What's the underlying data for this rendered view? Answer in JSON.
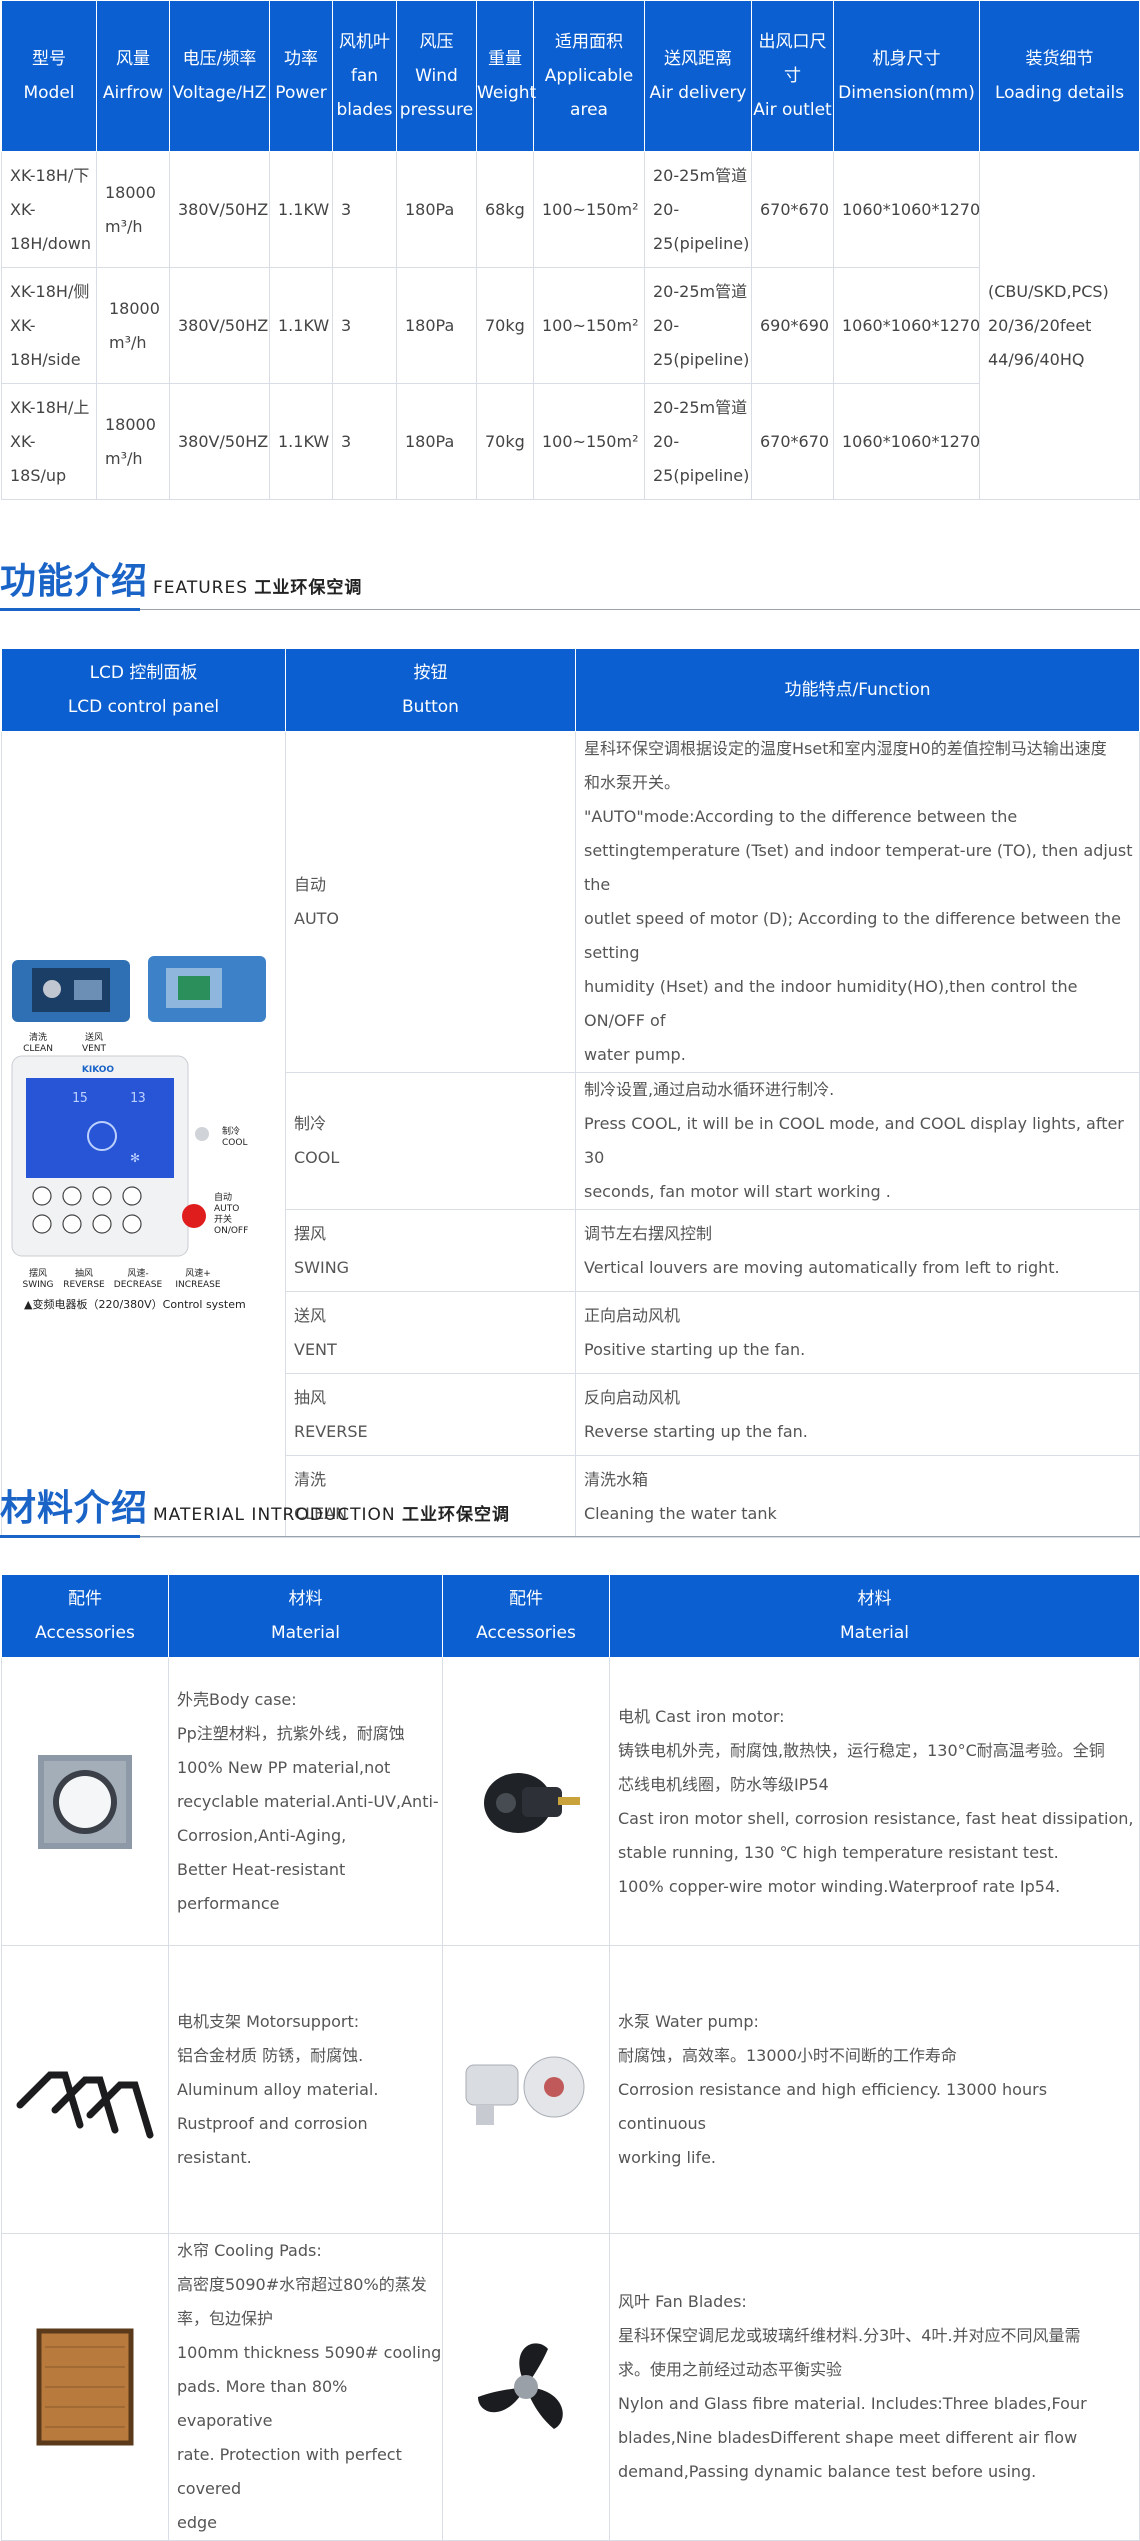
{
  "spec_table": {
    "headers": [
      {
        "zh": "型号",
        "en": "Model"
      },
      {
        "zh": "风量",
        "en": "Airfrow"
      },
      {
        "zh": "电压/频率",
        "en": "Voltage/HZ"
      },
      {
        "zh": "功率",
        "en": "Power"
      },
      {
        "zh": "风机叶",
        "en": "fan blades"
      },
      {
        "zh": "风压",
        "en": "Wind pressure"
      },
      {
        "zh": "重量",
        "en": "Weight"
      },
      {
        "zh": "适用面积",
        "en": "Applicable area"
      },
      {
        "zh": "送风距离",
        "en": "Air delivery"
      },
      {
        "zh": "出风口尺寸",
        "en": "Air outlet"
      },
      {
        "zh": "机身尺寸",
        "en": "Dimension(mm)"
      },
      {
        "zh": "装货细节",
        "en": "Loading details"
      }
    ],
    "rows": [
      {
        "model_a": "XK-18H/下",
        "model_b": "XK-",
        "model_c": "18H/down",
        "airflow_a": "18000",
        "airflow_b": "m³/h",
        "voltage": "380V/50HZ",
        "power": "1.1KW",
        "blades": "3",
        "pressure": "180Pa",
        "weight": "68kg",
        "area": "100~150m²",
        "delivery_a": "20-25m管道",
        "delivery_b": "20-",
        "delivery_c": "25(pipeline)",
        "outlet": "670*670",
        "dimension": "1060*1060*1270"
      },
      {
        "model_a": "XK-18H/侧",
        "model_b": "XK-",
        "model_c": "18H/side",
        "airflow_a": "18000",
        "airflow_b": "m³/h",
        "voltage": "380V/50HZ",
        "power": "1.1KW",
        "blades": "3",
        "pressure": "180Pa",
        "weight": "70kg",
        "area": "100~150m²",
        "delivery_a": "20-25m管道",
        "delivery_b": "20-",
        "delivery_c": "25(pipeline)",
        "outlet": "690*690",
        "dimension": "1060*1060*1270"
      },
      {
        "model_a": "XK-18H/上",
        "model_b": "XK-",
        "model_c": "18S/up",
        "airflow_a": "18000",
        "airflow_b": "m³/h",
        "voltage": "380V/50HZ",
        "power": "1.1KW",
        "blades": "3",
        "pressure": "180Pa",
        "weight": "70kg",
        "area": "100~150m²",
        "delivery_a": "20-25m管道",
        "delivery_b": "20-",
        "delivery_c": "25(pipeline)",
        "outlet": "670*670",
        "dimension": "1060*1060*1270"
      }
    ],
    "loading": {
      "line1": "(CBU/SKD,PCS)",
      "line2": "20/36/20feet",
      "line3": "44/96/40HQ"
    }
  },
  "features_heading": {
    "big": "功能介绍",
    "small_en": "FEATURES",
    "small_zh": "工业环保空调"
  },
  "features_table": {
    "headers": {
      "panel_zh": "LCD 控制面板",
      "panel_en": "LCD control panel",
      "button_zh": "按钮",
      "button_en": "Button",
      "function": "功能特点/Function"
    },
    "panel": {
      "clean": "清洗",
      "clean_en": "CLEAN",
      "vent": "送风",
      "vent_en": "VENT",
      "brand": "KIKOO",
      "cool": "制冷",
      "cool_en": "COOL",
      "auto": "自动",
      "auto_en": "AUTO",
      "onoff": "开关",
      "onoff_en": "ON/OFF",
      "swing": "摆风",
      "swing_en": "SWING",
      "reverse": "抽风",
      "reverse_en": "REVERSE",
      "decrease": "风速-",
      "decrease_en": "DECREASE",
      "increase": "风速+",
      "increase_en": "INCREASE",
      "caption": "▲变频电器板（220/380V）Control system"
    },
    "rows": [
      {
        "zh": "自动",
        "en": "AUTO",
        "lines": [
          "星科环保空调根据设定的温度Hset和室内湿度H0的差值控制马达输出速度",
          "和水泵开关。",
          "\"AUTO\"mode:According to the difference between the",
          "settingtemperature (Tset) and indoor temperat-ure (TO), then adjust the",
          "outlet speed of motor (D); According to the difference between the setting",
          "humidity (Hset) and the indoor humidity(HO),then control the ON/OFF of",
          "water pump."
        ]
      },
      {
        "zh": "制冷",
        "en": "COOL",
        "lines": [
          "制冷设置,通过启动水循环进行制冷.",
          "Press COOL, it will be in COOL mode, and COOL display lights, after 30",
          "seconds, fan motor will start working ."
        ]
      },
      {
        "zh": "摆风",
        "en": "SWING",
        "lines": [
          "调节左右摆风控制",
          "Vertical louvers are moving automatically from left to right."
        ]
      },
      {
        "zh": "送风",
        "en": "VENT",
        "lines": [
          "正向启动风机",
          "Positive starting up the fan."
        ]
      },
      {
        "zh": "抽风",
        "en": "REVERSE",
        "lines": [
          "反向启动风机",
          "Reverse starting up the fan."
        ]
      },
      {
        "zh": "清洗",
        "en": "CLEAN",
        "lines": [
          "清洗水箱",
          "Cleaning the water tank"
        ]
      }
    ]
  },
  "material_heading": {
    "big": "材料介绍",
    "small_en": "MATERIAL INTRODUCTION",
    "small_zh": "工业环保空调"
  },
  "material_table": {
    "headers": {
      "acc1_zh": "配件",
      "acc1_en": "Accessories",
      "mat1_zh": "材料",
      "mat1_en": "Material",
      "acc2_zh": "配件",
      "acc2_en": "Accessories",
      "mat2_zh": "材料",
      "mat2_en": "Material"
    },
    "rows": [
      {
        "left_icon": "body-case-icon",
        "left_lines": [
          "外壳Body case:",
          "Pp注塑材料，抗紫外线，耐腐蚀",
          "100% New PP material,not",
          "recyclable material.Anti-UV,Anti-",
          "Corrosion,Anti-Aging,",
          "Better Heat-resistant performance"
        ],
        "right_icon": "motor-icon",
        "right_lines": [
          "电机 Cast iron motor:",
          "铸铁电机外壳，耐腐蚀,散热快，运行稳定，130°C耐高温考验。全铜",
          "芯线电机线圈，防水等级IP54",
          "Cast iron motor shell, corrosion resistance, fast heat dissipation,",
          "stable running, 130 ℃ high temperature resistant test.",
          "100% copper-wire motor winding.Waterproof rate Ip54."
        ]
      },
      {
        "left_icon": "motor-support-icon",
        "left_lines": [
          "电机支架 Motorsupport:",
          "铝合金材质 防锈，耐腐蚀.",
          "Aluminum alloy material.",
          "Rustproof and corrosion resistant."
        ],
        "right_icon": "water-pump-icon",
        "right_lines": [
          "水泵 Water pump:",
          "耐腐蚀，高效率。13000小时不间断的工作寿命",
          "Corrosion resistance and high efficiency. 13000 hours continuous",
          "working life."
        ]
      },
      {
        "left_icon": "cooling-pad-icon",
        "left_lines": [
          "水帘 Cooling Pads:",
          "高密度5090#水帘超过80%的蒸发",
          "率，包边保护",
          "100mm thickness 5090# cooling",
          "pads. More than 80% evaporative",
          "rate. Protection with perfect",
          "covered",
          "edge"
        ],
        "right_icon": "fan-blade-icon",
        "right_lines": [
          "风叶 Fan Blades:",
          "星科环保空调尼龙或玻璃纤维材料.分3叶、4叶.并对应不同风量需",
          "求。使用之前经过动态平衡实验",
          "Nylon and Glass fibre material. Includes:Three blades,Four",
          "blades,Nine bladesDifferent shape meet different air flow",
          "demand,Passing dynamic balance test before using."
        ]
      }
    ]
  },
  "colors": {
    "header_blue": "#0b5fd0",
    "heading_blue": "#1a64c8",
    "border": "#d8dde6"
  }
}
